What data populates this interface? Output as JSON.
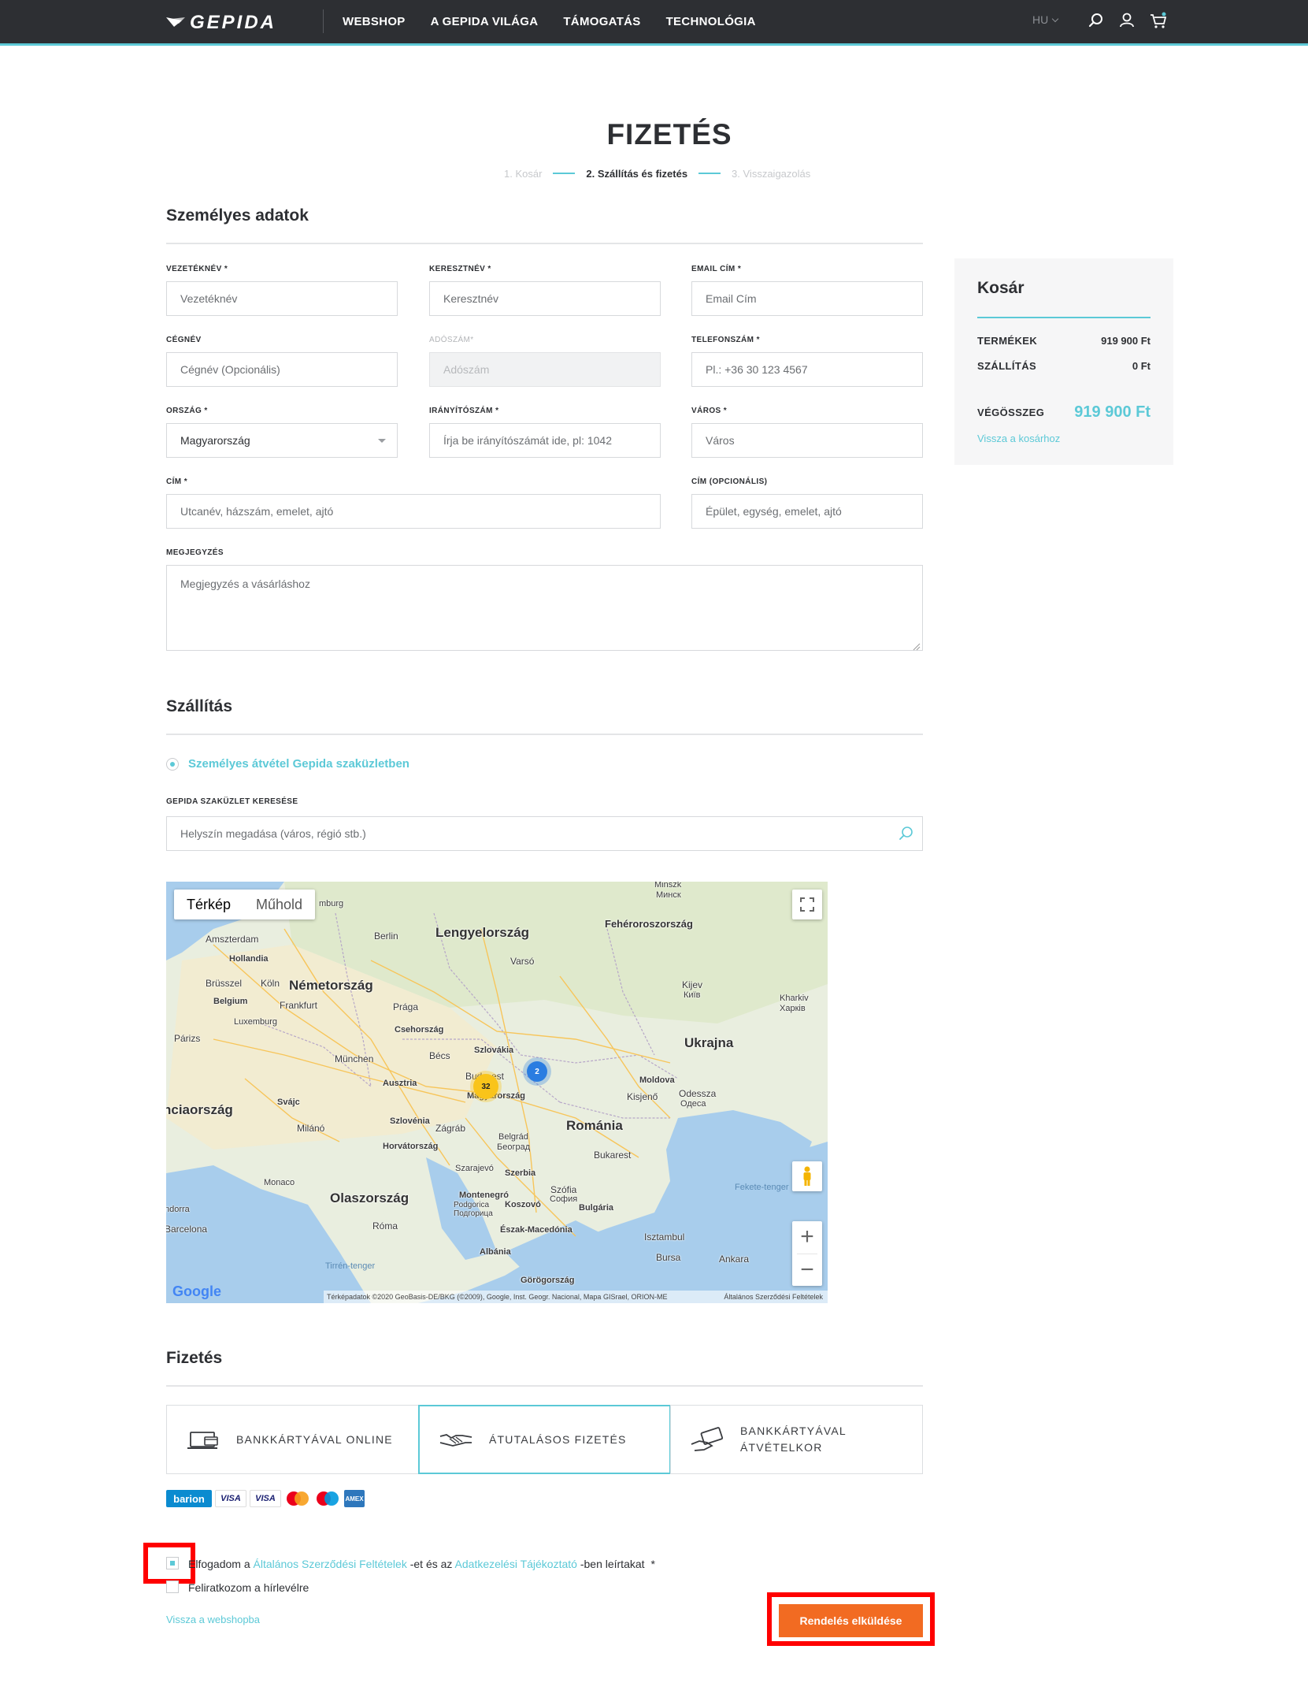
{
  "nav": {
    "brand": "GEPIDA",
    "menu": [
      "WEBSHOP",
      "A GEPIDA VILÁGA",
      "TÁMOGATÁS",
      "TECHNOLÓGIA"
    ],
    "lang": "HU",
    "icons": [
      "search-icon",
      "user-icon",
      "cart-icon"
    ]
  },
  "page": {
    "title": "FIZETÉS",
    "steps": [
      "1. Kosár",
      "2. Szállítás és fizetés",
      "3. Visszaigazolás"
    ],
    "active_step": 1
  },
  "personal": {
    "title": "Személyes adatok",
    "fields": {
      "lastname": {
        "label": "VEZETÉKNÉV *",
        "placeholder": "Vezetéknév"
      },
      "firstname": {
        "label": "KERESZTNÉV *",
        "placeholder": "Keresztnév"
      },
      "email": {
        "label": "EMAIL CÍM *",
        "placeholder": "Email Cím"
      },
      "company": {
        "label": "CÉGNÉV",
        "placeholder": "Cégnév (Opcionális)"
      },
      "taxno": {
        "label": "ADÓSZÁM*",
        "placeholder": "Adószám"
      },
      "phone": {
        "label": "TELEFONSZÁM *",
        "placeholder": "Pl.: +36 30 123 4567"
      },
      "country": {
        "label": "ORSZÁG *",
        "value": "Magyarország"
      },
      "zip": {
        "label": "IRÁNYÍTÓSZÁM *",
        "placeholder": "Írja be irányítószámát ide, pl: 1042"
      },
      "city": {
        "label": "VÁROS *",
        "placeholder": "Város"
      },
      "address": {
        "label": "CÍM *",
        "placeholder": "Utcanév, házszám, emelet, ajtó"
      },
      "address2": {
        "label": "CÍM (OPCIONÁLIS)",
        "placeholder": "Épület, egység, emelet, ajtó"
      },
      "note": {
        "label": "MEGJEGYZÉS",
        "placeholder": "Megjegyzés a vásárláshoz"
      }
    }
  },
  "cart": {
    "title": "Kosár",
    "products_label": "TERMÉKEK",
    "products_value": "919 900 Ft",
    "shipping_label": "SZÁLLÍTÁS",
    "shipping_value": "0 Ft",
    "total_label": "VÉGÖSSZEG",
    "total_value": "919 900 Ft",
    "back_link": "Vissza a kosárhoz"
  },
  "shipping": {
    "title": "Szállítás",
    "option": "Személyes átvétel Gepida szaküzletben",
    "search_label": "GEPIDA SZAKÜZLET KERESÉSE",
    "search_placeholder": "Helyszín megadása (város, régió stb.)"
  },
  "map": {
    "tabs": [
      "Térkép",
      "Műhold"
    ],
    "active_tab": "Térkép",
    "labels": {
      "countries": [
        "Lengyelország",
        "Németország",
        "Ukrajna",
        "Románia",
        "Olaszország",
        "nciaország",
        "Fehéroroszország"
      ],
      "cities": [
        "Minszk",
        "Минск",
        "Berlin",
        "Amszterdam",
        "Hollandia",
        "Varsó",
        "Kijev",
        "Киïв",
        "Kharkiv",
        "Харків",
        "Brüsszel",
        "Belgium",
        "Köln",
        "Frankfurt",
        "Luxemburg",
        "Prága",
        "Csehország",
        "Párizs",
        "München",
        "Bécs",
        "Szlovákia",
        "Ausztria",
        "Bud",
        "est",
        "Magyarország",
        "Moldova",
        "Kisjenő",
        "Odessza",
        "Одеса",
        "Svájc",
        "Milánó",
        "Szlovénia",
        "Zágráb",
        "Horvátország",
        "Belgrád",
        "Београд",
        "Bukarest",
        "Monaco",
        "Szarajevó",
        "Szerbia",
        "Szófia",
        "София",
        "Bulgária",
        "Montenegró",
        "Podgorica",
        "Подгорица",
        "Koszovó",
        "Észak-Macedónia",
        "Isztambul",
        "Bursa",
        "Albánia",
        "Görögország",
        "Ankara",
        "Róma",
        "Barcelona",
        "ndorra",
        "Tirrén-tenger",
        "Fekete-tenger",
        "mburg"
      ],
      "clusters": [
        "32",
        "2"
      ]
    },
    "attribution": "Térképadatok ©2020 GeoBasis-DE/BKG (©2009), Google, Inst. Geogr. Nacional, Mapa GISrael, ORION-ME",
    "terms": "Általános Szerződési Feltételek",
    "google": "Google",
    "controls": {
      "zoom_in": "+",
      "zoom_out": "−"
    }
  },
  "payment": {
    "title": "Fizetés",
    "options": [
      {
        "label": "BANKKÁRTYÁVAL ONLINE",
        "icon": "laptop-card-icon"
      },
      {
        "label": "ÁTUTALÁSOS FIZETÉS",
        "icon": "handshake-icon"
      },
      {
        "label_line1": "BANKKÁRTYÁVAL",
        "label_line2": "ÁTVÉTELKOR",
        "icon": "card-hand-icon"
      }
    ],
    "selected": 1,
    "cards": [
      "barion",
      "VISA",
      "VISA",
      "mastercard",
      "maestro",
      "amex"
    ]
  },
  "consent": {
    "terms_pre": "Elfogadom a",
    "terms_link": "Általános Szerződési Feltételek",
    "terms_mid": "-et és az",
    "privacy_link": "Adatkezelési Tájékoztató",
    "terms_post": "-ben leírtakat",
    "terms_req": "*",
    "newsletter": "Feliratkozom a hírlevélre"
  },
  "footer": {
    "back_link": "Vissza a webshopba",
    "submit": "Rendelés elküldése"
  },
  "colors": {
    "accent": "#5cc9d7",
    "nav": "#2d2f33",
    "submit": "#f26b22",
    "highlight": "#ff0000"
  }
}
